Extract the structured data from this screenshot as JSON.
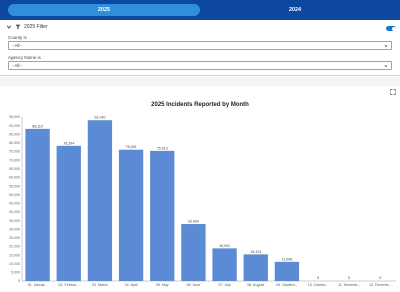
{
  "tabs": [
    {
      "label": "2025",
      "active": true
    },
    {
      "label": "2024",
      "active": false
    }
  ],
  "filter": {
    "title": "2025 Filter",
    "county_label": "County is",
    "county_value": "- All -",
    "agency_label": "Agency Name is",
    "agency_value": "- All -",
    "toggle_on": true
  },
  "colors": {
    "topbar": "#0d47a1",
    "active_tab": "#2f8fd8",
    "bar": "#5b8bd4"
  },
  "chart_data": {
    "type": "bar",
    "title": "2025 Incidents Reported by Month",
    "xlabel": "",
    "ylabel": "",
    "ylim": [
      0,
      95000
    ],
    "yticks": [
      "0",
      "5,000",
      "10,000",
      "15,000",
      "20,000",
      "25,000",
      "30,000",
      "35,000",
      "40,000",
      "45,000",
      "50,000",
      "55,000",
      "60,000",
      "65,000",
      "70,000",
      "75,000",
      "80,000",
      "85,000",
      "90,000",
      "95,000"
    ],
    "ytick_values": [
      0,
      5000,
      10000,
      15000,
      20000,
      25000,
      30000,
      35000,
      40000,
      45000,
      50000,
      55000,
      60000,
      65000,
      70000,
      75000,
      80000,
      85000,
      90000,
      95000
    ],
    "categories": [
      "01. Januar...",
      "02. Februa...",
      "03. March",
      "04. April",
      "05. May",
      "06. June",
      "07. July",
      "08. August",
      "09. Septem...",
      "10. Octobe...",
      "11. Novemb...",
      "12. Decemb..."
    ],
    "values": [
      88119,
      78294,
      93140,
      76061,
      75413,
      33004,
      18902,
      15413,
      11096,
      0,
      0,
      0
    ],
    "value_labels": [
      "88,119",
      "78,294",
      "93,140",
      "76,061",
      "75,413",
      "33,004",
      "18,902",
      "15,413",
      "11,096",
      "0",
      "0",
      "0"
    ],
    "grid": false,
    "legend": "none"
  }
}
